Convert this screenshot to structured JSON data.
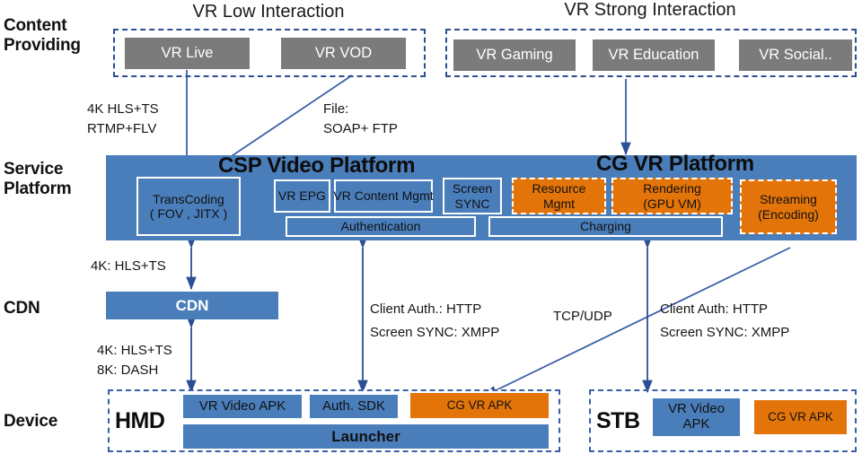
{
  "rows": {
    "content_providing": "Content\nProviding",
    "service_platform": "Service\nPlatform",
    "cdn": "CDN",
    "device": "Device"
  },
  "content": {
    "low_group_title": "VR Low Interaction",
    "strong_group_title": "VR Strong Interaction",
    "low_items": [
      "VR Live",
      "VR VOD"
    ],
    "strong_items": [
      "VR Gaming",
      "VR Education",
      "VR Social.."
    ]
  },
  "links": {
    "live_to_csp": "4K HLS+TS\nRTMP+FLV",
    "vod_to_csp": "File:\nSOAP+ FTP",
    "csp_to_cdn": "4K: HLS+TS",
    "cdn_to_device": "4K: HLS+TS\n8K: DASH",
    "csp_to_hmd_1": "Client Auth.: HTTP",
    "csp_to_hmd_2": "Screen SYNC: XMPP",
    "cg_transport": "TCP/UDP",
    "cg_to_stb_1": "Client Auth: HTTP",
    "cg_to_stb_2": "Screen SYNC: XMPP"
  },
  "platform": {
    "csp_title": "CSP Video Platform",
    "cg_title": "CG VR Platform",
    "transcoding_l1": "TransCoding",
    "transcoding_l2": "( FOV , JITX )",
    "vr_epg": "VR EPG",
    "vr_content_mgmt": "VR Content Mgmt",
    "screen_sync_l1": "Screen",
    "screen_sync_l2": "SYNC",
    "authentication": "Authentication",
    "resource_mgmt_l1": "Resource",
    "resource_mgmt_l2": "Mgmt",
    "rendering_l1": "Rendering",
    "rendering_l2": "(GPU VM)",
    "charging": "Charging",
    "streaming_l1": "Streaming",
    "streaming_l2": "(Encoding)"
  },
  "cdn": {
    "label": "CDN"
  },
  "devices": {
    "hmd_name": "HMD",
    "hmd_items": [
      "VR Video APK",
      "Auth. SDK",
      "CG VR APK"
    ],
    "hmd_launcher": "Launcher",
    "stb_name": "STB",
    "stb_video_apk_l1": "VR Video",
    "stb_video_apk_l2": "APK",
    "stb_cg_apk": "CG VR APK"
  },
  "colors": {
    "blue": "#4a7ebb",
    "orange": "#e3740a",
    "gray": "#7b7b7b",
    "dash_blue": "#2c4f93",
    "arrow_blue": "#3a5fa8"
  }
}
